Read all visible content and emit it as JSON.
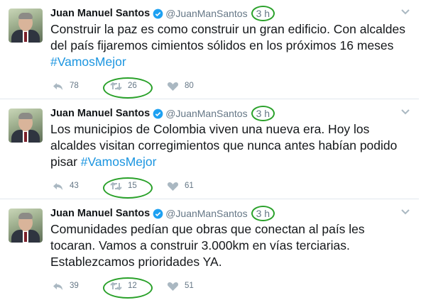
{
  "tweets": [
    {
      "name": "Juan Manuel Santos",
      "handle": "@JuanManSantos",
      "time": "3 h",
      "text_lines": [
        "Construir la paz es como construir un gran edificio. Con alcaldes del país fijaremos cimientos sólidos en los próximos 16 meses "
      ],
      "hashtag": "#VamosMejor",
      "replies": "78",
      "retweets": "26",
      "likes": "80"
    },
    {
      "name": "Juan Manuel Santos",
      "handle": "@JuanManSantos",
      "time": "3 h",
      "text_lines": [
        "Los municipios de Colombia viven una nueva era. Hoy los alcaldes visitan corregimientos que nunca antes habían podido pisar "
      ],
      "hashtag": "#VamosMejor",
      "replies": "43",
      "retweets": "15",
      "likes": "61"
    },
    {
      "name": "Juan Manuel Santos",
      "handle": "@JuanManSantos",
      "time": "3 h",
      "text_lines": [
        "Comunidades pedían que obras que conectan al país les tocaran. Vamos a construir 3.000km en vías terciarias. Establezcamos prioridades YA."
      ],
      "hashtag": "",
      "replies": "39",
      "retweets": "12",
      "likes": "51"
    }
  ],
  "icons": {
    "verified": "verified-badge-icon",
    "caret": "chevron-down-icon",
    "reply": "reply-icon",
    "retweet": "retweet-icon",
    "like": "heart-icon"
  },
  "colors": {
    "highlight_ring": "#2aa12a",
    "hashtag": "#1b95e0",
    "verified": "#1da1f2",
    "meta_text": "#657786"
  }
}
